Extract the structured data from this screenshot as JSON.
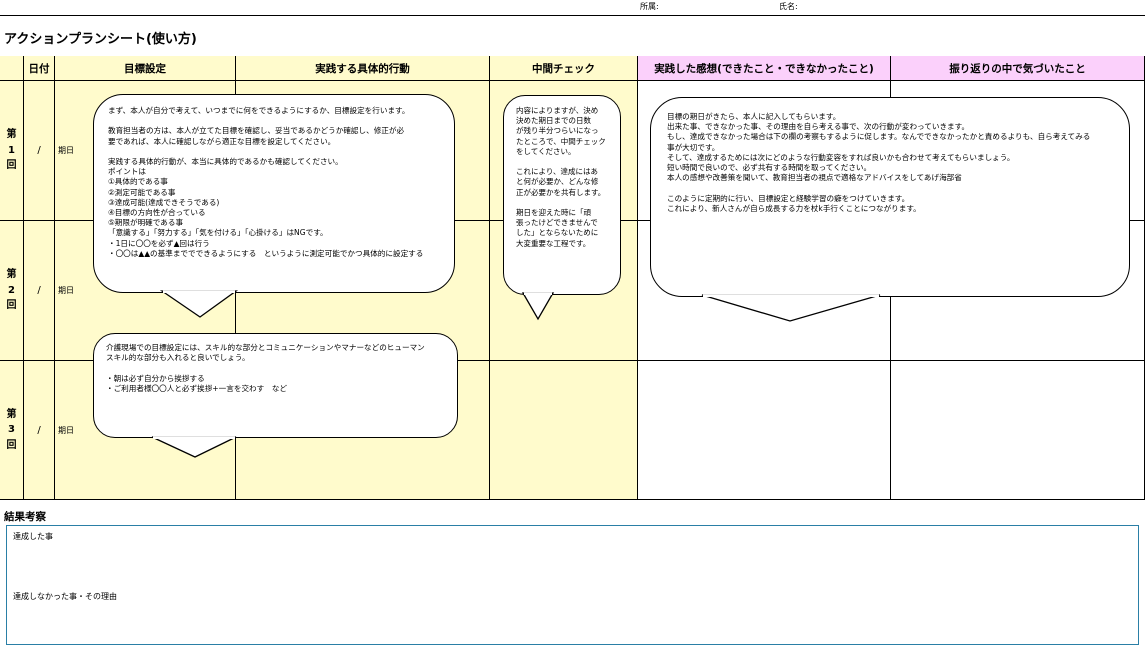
{
  "header": {
    "affiliation_label": "所属:",
    "name_label": "氏名:",
    "title": "アクションプランシート(使い方)"
  },
  "table": {
    "columns": {
      "date": "日付",
      "goal": "目標設定",
      "action": "実践する具体的行動",
      "mid_check": "中間チェック",
      "impression": "実践した感想(できたこと・できなかったこと)",
      "reflection": "振り返りの中で気づいたこと"
    },
    "rows": [
      {
        "label": [
          "第",
          "1",
          "回"
        ],
        "date": "/",
        "deadline": "期日"
      },
      {
        "label": [
          "第",
          "2",
          "回"
        ],
        "date": "/",
        "deadline": "期日"
      },
      {
        "label": [
          "第",
          "3",
          "回"
        ],
        "date": "/",
        "deadline": "期日"
      }
    ],
    "colors": {
      "yellow": "#fffbcc",
      "pink": "#fbd0fb",
      "accent": "#2a7fa6"
    }
  },
  "bubbles": {
    "goal_guide": "まず、本人が自分で考えて、いつまでに何をできるようにするか、目標設定を行います。\n\n教育担当者の方は、本人が立てた目標を確認し、妥当であるかどうか確認し、修正が必\n要であれば、本人に確認しながら適正な目標を設定してください。\n\n実践する具体的行動が、本当に具体的であるかも確認してください。\nポイントは\n①具体的である事\n②測定可能である事\n③達成可能(達成できそうである)\n④目標の方向性が合っている\n⑤期限が明確である事\n「意識する」「努力する」「気を付ける」「心掛ける」はNGです。\n・1日に〇〇を必ず▲回は行う\n・〇〇は▲▲の基準まででできるようにする　というように測定可能でかつ具体的に設定する",
    "mid_check": "内容によりますが、決め\n決めた期日までの日数\nが残り半分つらいになっ\nたところで、中間チェック\nをしてください。\n\nこれにより、達成にはあ\nと何が必要か、どんな修\n正が必要かを共有します。\n\n期日を迎えた時に「頑\n張ったけどできませんで\nした」とならないために\n大変重要な工程です。",
    "impression": "目標の期日がきたら、本人に記入してもらいます。\n出来た事、できなかった事、その理由を自ら考える事で、次の行動が変わっていきます。\nもし、達成できなかった場合は下の欄の考察もするように促します。なんでできなかったかと責めるよりも、自ら考えてみる\n事が大切です。\nそして、達成するためには次にどのような行動変容をすれば良いかも合わせて考えてもらいましょう。\n短い時間で良いので、必ず共有する時間を取ってください。\n本人の感想や改善策を聞いて、教育担当者の視点で適格なアドバイスをしてあげ海部省\n\nこのように定期的に行い、目標設定と経験学習の癖をつけていきます。\nこれにより、新人さんが自ら成長する力を杖k手行くことにつながります。",
    "care_goal": "介護現場での目標設定には、スキル的な部分とコミュニケーションやマナーなどのヒューマン\nスキル的な部分も入れると良いでしょう。\n\n・朝は必ず自分から挨拶する\n・ご利用者様〇〇人と必ず挨拶+一言を交わす　など"
  },
  "results": {
    "title": "結果考察",
    "achieved": "達成した事",
    "not_achieved": "達成しなかった事・その理由"
  }
}
